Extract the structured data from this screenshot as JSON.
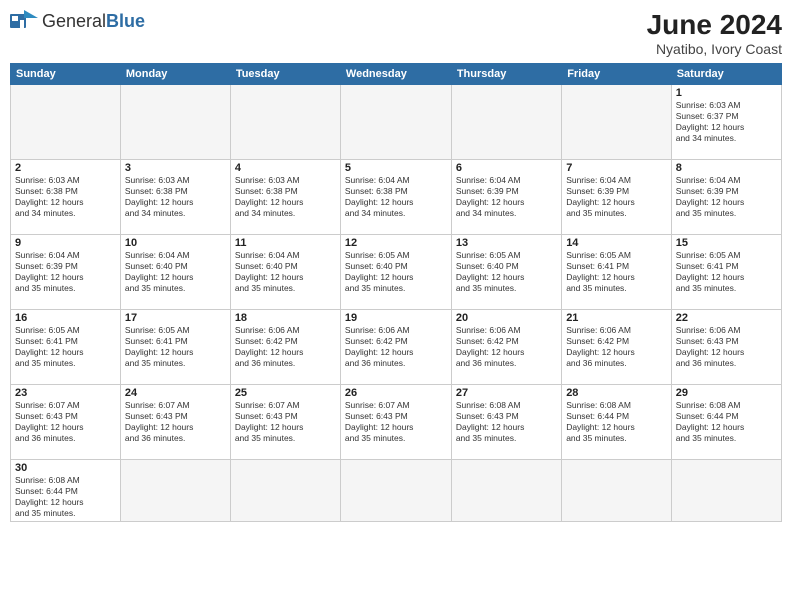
{
  "header": {
    "logo_general": "General",
    "logo_blue": "Blue",
    "title": "June 2024",
    "subtitle": "Nyatibo, Ivory Coast"
  },
  "weekdays": [
    "Sunday",
    "Monday",
    "Tuesday",
    "Wednesday",
    "Thursday",
    "Friday",
    "Saturday"
  ],
  "weeks": [
    [
      {
        "day": null,
        "info": ""
      },
      {
        "day": null,
        "info": ""
      },
      {
        "day": null,
        "info": ""
      },
      {
        "day": null,
        "info": ""
      },
      {
        "day": null,
        "info": ""
      },
      {
        "day": null,
        "info": ""
      },
      {
        "day": "1",
        "info": "Sunrise: 6:03 AM\nSunset: 6:37 PM\nDaylight: 12 hours\nand 34 minutes."
      }
    ],
    [
      {
        "day": "2",
        "info": "Sunrise: 6:03 AM\nSunset: 6:38 PM\nDaylight: 12 hours\nand 34 minutes."
      },
      {
        "day": "3",
        "info": "Sunrise: 6:03 AM\nSunset: 6:38 PM\nDaylight: 12 hours\nand 34 minutes."
      },
      {
        "day": "4",
        "info": "Sunrise: 6:03 AM\nSunset: 6:38 PM\nDaylight: 12 hours\nand 34 minutes."
      },
      {
        "day": "5",
        "info": "Sunrise: 6:04 AM\nSunset: 6:38 PM\nDaylight: 12 hours\nand 34 minutes."
      },
      {
        "day": "6",
        "info": "Sunrise: 6:04 AM\nSunset: 6:39 PM\nDaylight: 12 hours\nand 34 minutes."
      },
      {
        "day": "7",
        "info": "Sunrise: 6:04 AM\nSunset: 6:39 PM\nDaylight: 12 hours\nand 35 minutes."
      },
      {
        "day": "8",
        "info": "Sunrise: 6:04 AM\nSunset: 6:39 PM\nDaylight: 12 hours\nand 35 minutes."
      }
    ],
    [
      {
        "day": "9",
        "info": "Sunrise: 6:04 AM\nSunset: 6:39 PM\nDaylight: 12 hours\nand 35 minutes."
      },
      {
        "day": "10",
        "info": "Sunrise: 6:04 AM\nSunset: 6:40 PM\nDaylight: 12 hours\nand 35 minutes."
      },
      {
        "day": "11",
        "info": "Sunrise: 6:04 AM\nSunset: 6:40 PM\nDaylight: 12 hours\nand 35 minutes."
      },
      {
        "day": "12",
        "info": "Sunrise: 6:05 AM\nSunset: 6:40 PM\nDaylight: 12 hours\nand 35 minutes."
      },
      {
        "day": "13",
        "info": "Sunrise: 6:05 AM\nSunset: 6:40 PM\nDaylight: 12 hours\nand 35 minutes."
      },
      {
        "day": "14",
        "info": "Sunrise: 6:05 AM\nSunset: 6:41 PM\nDaylight: 12 hours\nand 35 minutes."
      },
      {
        "day": "15",
        "info": "Sunrise: 6:05 AM\nSunset: 6:41 PM\nDaylight: 12 hours\nand 35 minutes."
      }
    ],
    [
      {
        "day": "16",
        "info": "Sunrise: 6:05 AM\nSunset: 6:41 PM\nDaylight: 12 hours\nand 35 minutes."
      },
      {
        "day": "17",
        "info": "Sunrise: 6:05 AM\nSunset: 6:41 PM\nDaylight: 12 hours\nand 35 minutes."
      },
      {
        "day": "18",
        "info": "Sunrise: 6:06 AM\nSunset: 6:42 PM\nDaylight: 12 hours\nand 36 minutes."
      },
      {
        "day": "19",
        "info": "Sunrise: 6:06 AM\nSunset: 6:42 PM\nDaylight: 12 hours\nand 36 minutes."
      },
      {
        "day": "20",
        "info": "Sunrise: 6:06 AM\nSunset: 6:42 PM\nDaylight: 12 hours\nand 36 minutes."
      },
      {
        "day": "21",
        "info": "Sunrise: 6:06 AM\nSunset: 6:42 PM\nDaylight: 12 hours\nand 36 minutes."
      },
      {
        "day": "22",
        "info": "Sunrise: 6:06 AM\nSunset: 6:43 PM\nDaylight: 12 hours\nand 36 minutes."
      }
    ],
    [
      {
        "day": "23",
        "info": "Sunrise: 6:07 AM\nSunset: 6:43 PM\nDaylight: 12 hours\nand 36 minutes."
      },
      {
        "day": "24",
        "info": "Sunrise: 6:07 AM\nSunset: 6:43 PM\nDaylight: 12 hours\nand 36 minutes."
      },
      {
        "day": "25",
        "info": "Sunrise: 6:07 AM\nSunset: 6:43 PM\nDaylight: 12 hours\nand 35 minutes."
      },
      {
        "day": "26",
        "info": "Sunrise: 6:07 AM\nSunset: 6:43 PM\nDaylight: 12 hours\nand 35 minutes."
      },
      {
        "day": "27",
        "info": "Sunrise: 6:08 AM\nSunset: 6:43 PM\nDaylight: 12 hours\nand 35 minutes."
      },
      {
        "day": "28",
        "info": "Sunrise: 6:08 AM\nSunset: 6:44 PM\nDaylight: 12 hours\nand 35 minutes."
      },
      {
        "day": "29",
        "info": "Sunrise: 6:08 AM\nSunset: 6:44 PM\nDaylight: 12 hours\nand 35 minutes."
      }
    ],
    [
      {
        "day": "30",
        "info": "Sunrise: 6:08 AM\nSunset: 6:44 PM\nDaylight: 12 hours\nand 35 minutes."
      },
      {
        "day": null,
        "info": ""
      },
      {
        "day": null,
        "info": ""
      },
      {
        "day": null,
        "info": ""
      },
      {
        "day": null,
        "info": ""
      },
      {
        "day": null,
        "info": ""
      },
      {
        "day": null,
        "info": ""
      }
    ]
  ]
}
